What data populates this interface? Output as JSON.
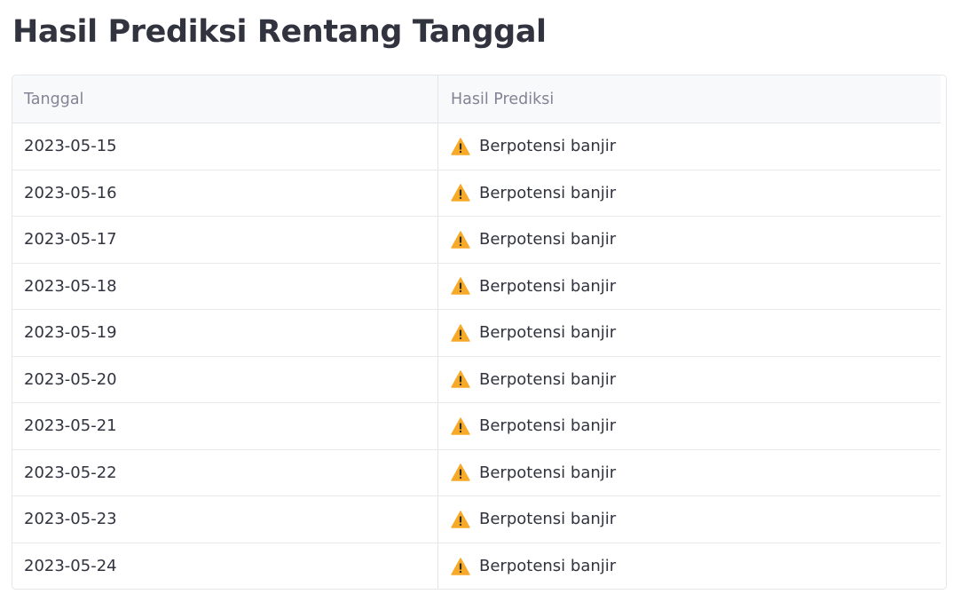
{
  "page": {
    "title": "Hasil Prediksi Rentang Tanggal"
  },
  "table": {
    "columns": [
      "Tanggal",
      "Hasil Prediksi"
    ],
    "rows": [
      {
        "date": "2023-05-15",
        "icon": "warning-icon",
        "prediction": "Berpotensi banjir"
      },
      {
        "date": "2023-05-16",
        "icon": "warning-icon",
        "prediction": "Berpotensi banjir"
      },
      {
        "date": "2023-05-17",
        "icon": "warning-icon",
        "prediction": "Berpotensi banjir"
      },
      {
        "date": "2023-05-18",
        "icon": "warning-icon",
        "prediction": "Berpotensi banjir"
      },
      {
        "date": "2023-05-19",
        "icon": "warning-icon",
        "prediction": "Berpotensi banjir"
      },
      {
        "date": "2023-05-20",
        "icon": "warning-icon",
        "prediction": "Berpotensi banjir"
      },
      {
        "date": "2023-05-21",
        "icon": "warning-icon",
        "prediction": "Berpotensi banjir"
      },
      {
        "date": "2023-05-22",
        "icon": "warning-icon",
        "prediction": "Berpotensi banjir"
      },
      {
        "date": "2023-05-23",
        "icon": "warning-icon",
        "prediction": "Berpotensi banjir"
      },
      {
        "date": "2023-05-24",
        "icon": "warning-icon",
        "prediction": "Berpotensi banjir"
      }
    ]
  },
  "colors": {
    "warning": "#f7a928",
    "text": "#31333f",
    "header_text": "#808495",
    "header_bg": "#f8f9fb"
  }
}
